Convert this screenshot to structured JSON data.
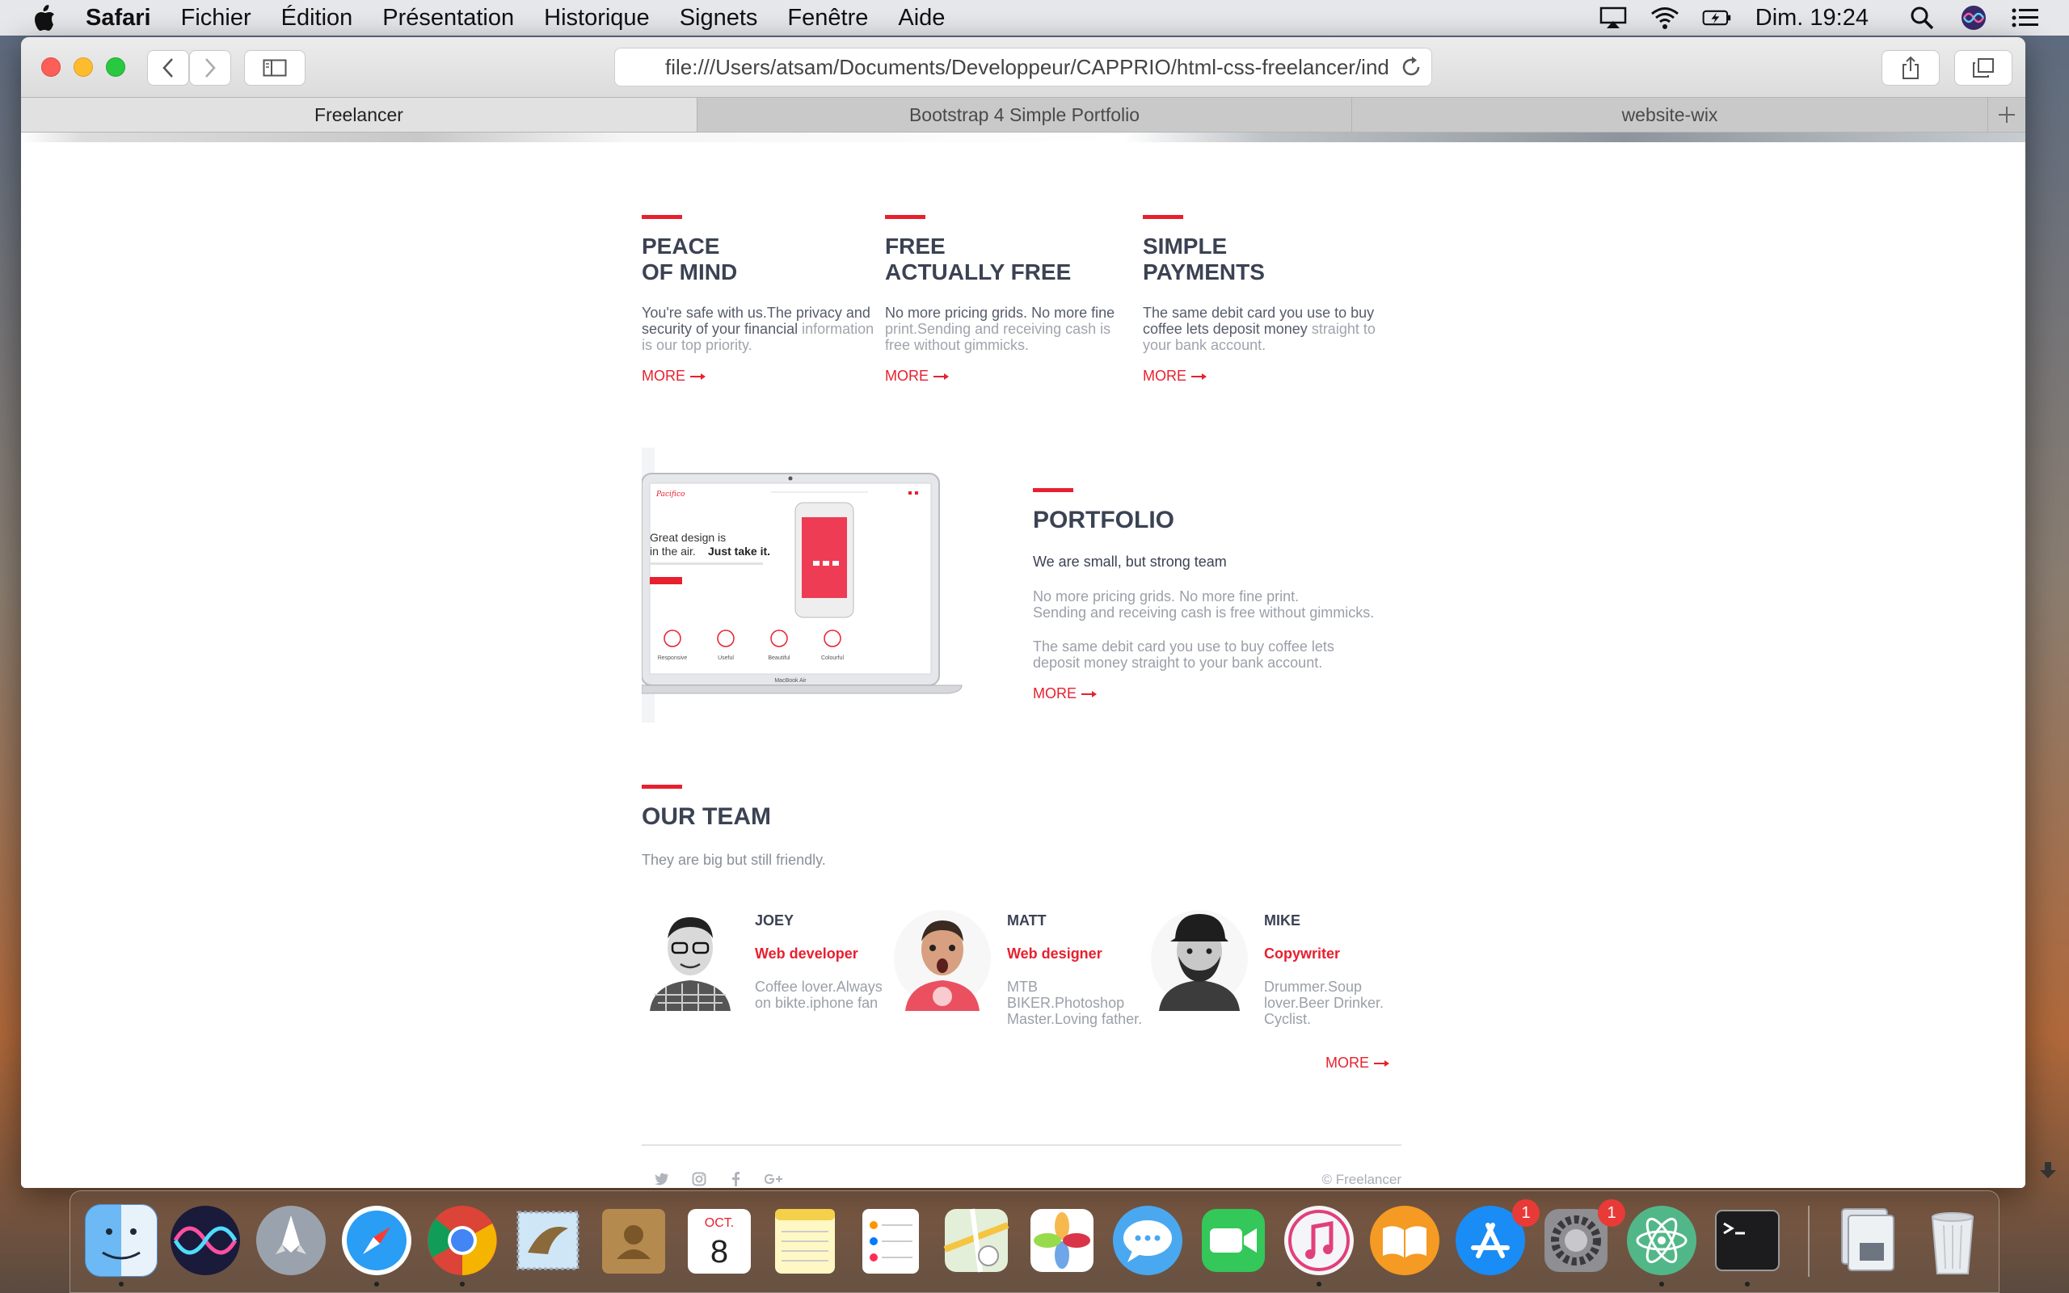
{
  "menubar": {
    "app_name": "Safari",
    "items": [
      "Fichier",
      "Édition",
      "Présentation",
      "Historique",
      "Signets",
      "Fenêtre",
      "Aide"
    ],
    "clock": "Dim. 19:24"
  },
  "browser": {
    "url": "file:///Users/atsam/Documents/Developpeur/CAPPRIO/html-css-freelancer/ind",
    "tabs": [
      {
        "label": "Freelancer",
        "active": true
      },
      {
        "label": "Bootstrap 4 Simple Portfolio",
        "active": false
      },
      {
        "label": "website-wix",
        "active": false
      }
    ]
  },
  "features": [
    {
      "title_line1": "PEACE",
      "title_line2": "OF MIND",
      "desc_dark": "You're safe with us.The privacy and security of your financial",
      "desc_light": "information is our top priority.",
      "more": "MORE"
    },
    {
      "title_line1": "FREE",
      "title_line2": "ACTUALLY FREE",
      "desc_dark": "No more pricing grids. No more fine",
      "desc_light": "print.Sending and receiving cash is free without gimmicks.",
      "more": "MORE"
    },
    {
      "title_line1": "SIMPLE",
      "title_line2": "PAYMENTS",
      "desc_dark": "The same debit card you use to buy coffee lets deposit money",
      "desc_light": "straight to your bank account.",
      "more": "MORE"
    }
  ],
  "laptop": {
    "brand": "Pacifico",
    "headline_line1": "Great design is",
    "headline_line2a": "in the air.",
    "headline_line2b": "Just take it.",
    "features": [
      "Responsive",
      "Useful",
      "Beautiful",
      "Colourful"
    ],
    "model": "MacBook Air"
  },
  "portfolio": {
    "title": "PORTFOLIO",
    "subtitle": "We are small, but strong team",
    "p1_line1": "No more pricing grids. No more fine print.",
    "p1_line2": "Sending and receiving cash is free without gimmicks.",
    "p2": "The same debit card you use to buy coffee lets deposit money straight to your bank account.",
    "more": "MORE"
  },
  "team": {
    "title": "OUR TEAM",
    "subtitle": "They are big but still friendly.",
    "members": [
      {
        "name": "JOEY",
        "role": "Web developer",
        "bio": "Coffee lover.Always on bikte.iphone fan"
      },
      {
        "name": "MATT",
        "role": "Web designer",
        "bio": "MTB BIKER.Photoshop Master.Loving father."
      },
      {
        "name": "MIKE",
        "role": "Copywriter",
        "bio": "Drummer.Soup lover.Beer Drinker. Cyclist."
      }
    ],
    "more": "MORE"
  },
  "footer": {
    "copyright": "© Freelancer"
  },
  "dock": {
    "calendar_month": "OCT.",
    "calendar_day": "8",
    "appstore_badge": "1",
    "prefs_badge": "1"
  }
}
